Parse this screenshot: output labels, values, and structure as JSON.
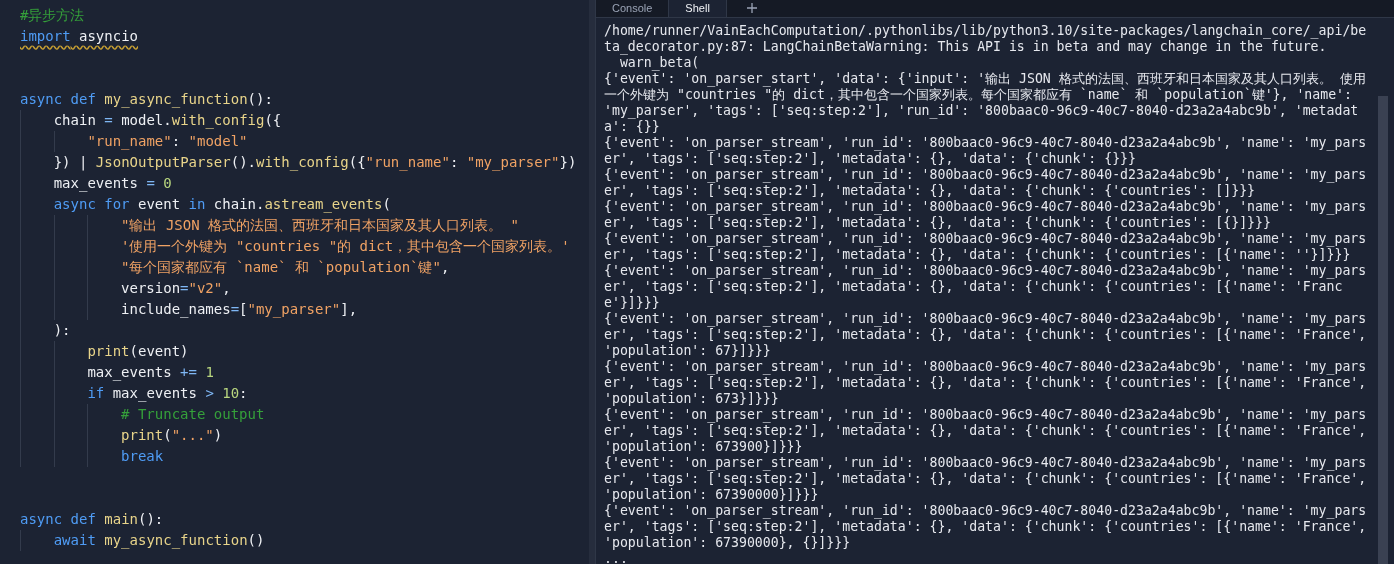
{
  "editor": {
    "lines": [
      {
        "kind": "code",
        "tokens": [
          {
            "text": "#异步方法",
            "kind": "comment"
          }
        ]
      },
      {
        "kind": "code",
        "warning": true,
        "tokens": [
          {
            "text": "import",
            "kind": "keyword"
          },
          {
            "text": " asyncio",
            "kind": "plain"
          }
        ]
      },
      {
        "kind": "blank"
      },
      {
        "kind": "blank"
      },
      {
        "kind": "code",
        "tokens": [
          {
            "text": "async def ",
            "kind": "keyword"
          },
          {
            "text": "my_async_function",
            "kind": "function"
          },
          {
            "text": "():",
            "kind": "plain"
          }
        ]
      },
      {
        "kind": "code",
        "tokens": [
          {
            "text": "    chain ",
            "kind": "plain"
          },
          {
            "text": "= ",
            "kind": "operator"
          },
          {
            "text": "model.",
            "kind": "plain"
          },
          {
            "text": "with_config",
            "kind": "function"
          },
          {
            "text": "({",
            "kind": "plain"
          }
        ]
      },
      {
        "kind": "code",
        "tokens": [
          {
            "text": "        \"run_name\"",
            "kind": "string"
          },
          {
            "text": ": ",
            "kind": "plain"
          },
          {
            "text": "\"model\"",
            "kind": "string"
          }
        ]
      },
      {
        "kind": "code",
        "tokens": [
          {
            "text": "    }) | ",
            "kind": "plain"
          },
          {
            "text": "JsonOutputParser",
            "kind": "function"
          },
          {
            "text": "().",
            "kind": "plain"
          },
          {
            "text": "with_config",
            "kind": "function"
          },
          {
            "text": "({",
            "kind": "plain"
          },
          {
            "text": "\"run_name\"",
            "kind": "string"
          },
          {
            "text": ": ",
            "kind": "plain"
          },
          {
            "text": "\"my_parser\"",
            "kind": "string"
          },
          {
            "text": "})",
            "kind": "plain"
          }
        ]
      },
      {
        "kind": "code",
        "tokens": [
          {
            "text": "    max_events ",
            "kind": "plain"
          },
          {
            "text": "= ",
            "kind": "operator"
          },
          {
            "text": "0",
            "kind": "number"
          }
        ]
      },
      {
        "kind": "code",
        "tokens": [
          {
            "text": "    async for ",
            "kind": "keyword"
          },
          {
            "text": "event ",
            "kind": "plain"
          },
          {
            "text": "in ",
            "kind": "keyword"
          },
          {
            "text": "chain.",
            "kind": "plain"
          },
          {
            "text": "astream_events",
            "kind": "function"
          },
          {
            "text": "(",
            "kind": "plain"
          }
        ]
      },
      {
        "kind": "code",
        "tokens": [
          {
            "text": "            \"输出 JSON 格式的法国、西班牙和日本国家及其人口列表。 \"",
            "kind": "string"
          }
        ]
      },
      {
        "kind": "code",
        "tokens": [
          {
            "text": "            '使用一个外键为 \"countries \"的 dict，其中包含一个国家列表。'",
            "kind": "string"
          }
        ]
      },
      {
        "kind": "code",
        "tokens": [
          {
            "text": "            \"每个国家都应有 `name` 和 `population`键\"",
            "kind": "string"
          },
          {
            "text": ",",
            "kind": "plain"
          }
        ]
      },
      {
        "kind": "code",
        "tokens": [
          {
            "text": "            version",
            "kind": "plain"
          },
          {
            "text": "=",
            "kind": "operator"
          },
          {
            "text": "\"v2\"",
            "kind": "string"
          },
          {
            "text": ",",
            "kind": "plain"
          }
        ]
      },
      {
        "kind": "code",
        "tokens": [
          {
            "text": "            include_names",
            "kind": "plain"
          },
          {
            "text": "=",
            "kind": "operator"
          },
          {
            "text": "[",
            "kind": "plain"
          },
          {
            "text": "\"my_parser\"",
            "kind": "string"
          },
          {
            "text": "],",
            "kind": "plain"
          }
        ]
      },
      {
        "kind": "code",
        "tokens": [
          {
            "text": "    ):",
            "kind": "plain"
          }
        ]
      },
      {
        "kind": "code",
        "tokens": [
          {
            "text": "        print",
            "kind": "function"
          },
          {
            "text": "(event)",
            "kind": "plain"
          }
        ]
      },
      {
        "kind": "code",
        "tokens": [
          {
            "text": "        max_events ",
            "kind": "plain"
          },
          {
            "text": "+= ",
            "kind": "operator"
          },
          {
            "text": "1",
            "kind": "number"
          }
        ]
      },
      {
        "kind": "code",
        "tokens": [
          {
            "text": "        if ",
            "kind": "keyword"
          },
          {
            "text": "max_events ",
            "kind": "plain"
          },
          {
            "text": "> ",
            "kind": "operator"
          },
          {
            "text": "10",
            "kind": "number"
          },
          {
            "text": ":",
            "kind": "plain"
          }
        ]
      },
      {
        "kind": "code",
        "tokens": [
          {
            "text": "            # Truncate output",
            "kind": "comment"
          }
        ]
      },
      {
        "kind": "code",
        "tokens": [
          {
            "text": "            print",
            "kind": "function"
          },
          {
            "text": "(",
            "kind": "plain"
          },
          {
            "text": "\"...\"",
            "kind": "string"
          },
          {
            "text": ")",
            "kind": "plain"
          }
        ]
      },
      {
        "kind": "code",
        "tokens": [
          {
            "text": "            break",
            "kind": "keyword"
          }
        ]
      },
      {
        "kind": "blank"
      },
      {
        "kind": "blank"
      },
      {
        "kind": "code",
        "tokens": [
          {
            "text": "async def ",
            "kind": "keyword"
          },
          {
            "text": "main",
            "kind": "function"
          },
          {
            "text": "():",
            "kind": "plain"
          }
        ]
      },
      {
        "kind": "code",
        "tokens": [
          {
            "text": "    await ",
            "kind": "keyword"
          },
          {
            "text": "my_async_function",
            "kind": "function"
          },
          {
            "text": "()",
            "kind": "plain"
          }
        ]
      }
    ]
  },
  "panel": {
    "tabs": [
      {
        "label": "Console",
        "selected": false
      },
      {
        "label": "Shell",
        "selected": true
      }
    ],
    "output": [
      "/home/runner/VainEachComputation/.pythonlibs/lib/python3.10/site-packages/langchain_core/_api/beta_decorator.py:87: LangChainBetaWarning: This API is in beta and may change in the future.",
      "  warn_beta(",
      "{'event': 'on_parser_start', 'data': {'input': '输出 JSON 格式的法国、西班牙和日本国家及其人口列表。 使用一个外键为 \"countries \"的 dict，其中包含一个国家列表。每个国家都应有 `name` 和 `population`键'}, 'name': 'my_parser', 'tags': ['seq:step:2'], 'run_id': '800baac0-96c9-40c7-8040-d23a2a4abc9b', 'metadata': {}}",
      "{'event': 'on_parser_stream', 'run_id': '800baac0-96c9-40c7-8040-d23a2a4abc9b', 'name': 'my_parser', 'tags': ['seq:step:2'], 'metadata': {}, 'data': {'chunk': {}}}",
      "{'event': 'on_parser_stream', 'run_id': '800baac0-96c9-40c7-8040-d23a2a4abc9b', 'name': 'my_parser', 'tags': ['seq:step:2'], 'metadata': {}, 'data': {'chunk': {'countries': []}}}",
      "{'event': 'on_parser_stream', 'run_id': '800baac0-96c9-40c7-8040-d23a2a4abc9b', 'name': 'my_parser', 'tags': ['seq:step:2'], 'metadata': {}, 'data': {'chunk': {'countries': [{}]}}}",
      "{'event': 'on_parser_stream', 'run_id': '800baac0-96c9-40c7-8040-d23a2a4abc9b', 'name': 'my_parser', 'tags': ['seq:step:2'], 'metadata': {}, 'data': {'chunk': {'countries': [{'name': ''}]}}}",
      "{'event': 'on_parser_stream', 'run_id': '800baac0-96c9-40c7-8040-d23a2a4abc9b', 'name': 'my_parser', 'tags': ['seq:step:2'], 'metadata': {}, 'data': {'chunk': {'countries': [{'name': 'France'}]}}}",
      "{'event': 'on_parser_stream', 'run_id': '800baac0-96c9-40c7-8040-d23a2a4abc9b', 'name': 'my_parser', 'tags': ['seq:step:2'], 'metadata': {}, 'data': {'chunk': {'countries': [{'name': 'France', 'population': 67}]}}}",
      "{'event': 'on_parser_stream', 'run_id': '800baac0-96c9-40c7-8040-d23a2a4abc9b', 'name': 'my_parser', 'tags': ['seq:step:2'], 'metadata': {}, 'data': {'chunk': {'countries': [{'name': 'France', 'population': 673}]}}}",
      "{'event': 'on_parser_stream', 'run_id': '800baac0-96c9-40c7-8040-d23a2a4abc9b', 'name': 'my_parser', 'tags': ['seq:step:2'], 'metadata': {}, 'data': {'chunk': {'countries': [{'name': 'France', 'population': 673900}]}}}",
      "{'event': 'on_parser_stream', 'run_id': '800baac0-96c9-40c7-8040-d23a2a4abc9b', 'name': 'my_parser', 'tags': ['seq:step:2'], 'metadata': {}, 'data': {'chunk': {'countries': [{'name': 'France', 'population': 67390000}]}}}",
      "{'event': 'on_parser_stream', 'run_id': '800baac0-96c9-40c7-8040-d23a2a4abc9b', 'name': 'my_parser', 'tags': ['seq:step:2'], 'metadata': {}, 'data': {'chunk': {'countries': [{'name': 'France', 'population': 67390000}, {}]}}}",
      "..."
    ]
  }
}
